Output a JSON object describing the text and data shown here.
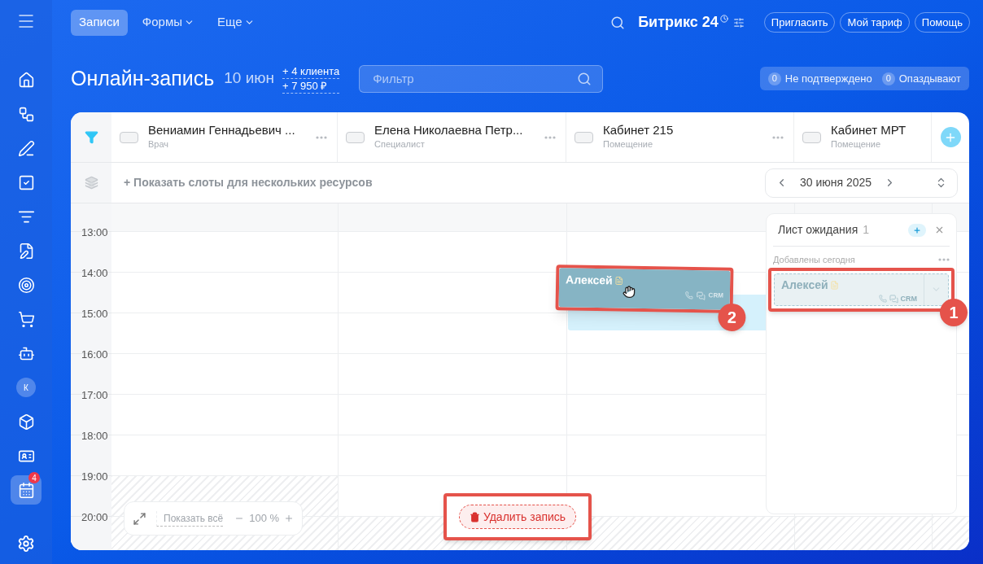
{
  "sidebar": {
    "items": [
      {
        "kind": "icon",
        "selected": false
      },
      {
        "kind": "icon",
        "selected": false
      },
      {
        "kind": "icon",
        "selected": false
      },
      {
        "kind": "icon",
        "selected": false
      },
      {
        "kind": "icon",
        "selected": false
      },
      {
        "kind": "icon",
        "selected": false
      },
      {
        "kind": "icon",
        "selected": false
      },
      {
        "kind": "icon",
        "selected": false
      },
      {
        "kind": "icon",
        "selected": false
      },
      {
        "kind": "avatar",
        "label": "К",
        "selected": false
      },
      {
        "kind": "icon",
        "selected": false
      },
      {
        "kind": "icon",
        "selected": false
      },
      {
        "kind": "icon",
        "selected": true,
        "badge": "4"
      }
    ]
  },
  "top_nav": {
    "tabs": [
      {
        "label": "Записи",
        "selected": true,
        "dropdown": false
      },
      {
        "label": "Формы",
        "selected": false,
        "dropdown": true
      },
      {
        "label": "Еще",
        "selected": false,
        "dropdown": true
      }
    ],
    "brand": "Битрикс 24",
    "buttons": [
      "Пригласить",
      "Мой тариф",
      "Помощь"
    ]
  },
  "header": {
    "title": "Онлайн-запись",
    "date": "10 июн",
    "stats": [
      "+ 4 клиента",
      "+ 7 950 ₽"
    ],
    "filter": {
      "placeholder": "Фильтр"
    },
    "counters": [
      {
        "count": "0",
        "label": "Не подтверждено"
      },
      {
        "count": "0",
        "label": "Опаздывают"
      }
    ]
  },
  "resources": [
    {
      "name": "Вениамин Геннадьевич ...",
      "role": "Врач",
      "menu": true
    },
    {
      "name": "Елена Николаевна Петр...",
      "role": "Специалист",
      "menu": true
    },
    {
      "name": "Кабинет 215",
      "role": "Помещение",
      "menu": true
    },
    {
      "name": "Кабинет МРТ",
      "role": "Помещение",
      "menu": false
    }
  ],
  "slots_link": "+ Показать слоты для нескольких ресурсов",
  "date_picker": "30 июня 2025",
  "times": [
    "13:00",
    "14:00",
    "15:00",
    "16:00",
    "17:00",
    "18:00",
    "19:00",
    "20:00"
  ],
  "waitlist": {
    "title": "Лист ожидания",
    "count": "1",
    "group": "Добавлены сегодня",
    "items": [
      {
        "name": "Алексей",
        "crm": "CRM"
      }
    ]
  },
  "dragged_booking": {
    "name": "Алексей",
    "crm": "CRM"
  },
  "zoom_controls": {
    "show_all": "Показать всё",
    "level": "100 %"
  },
  "delete_button": "Удалить запись",
  "annotations": [
    {
      "number": "1"
    },
    {
      "number": "2"
    }
  ]
}
